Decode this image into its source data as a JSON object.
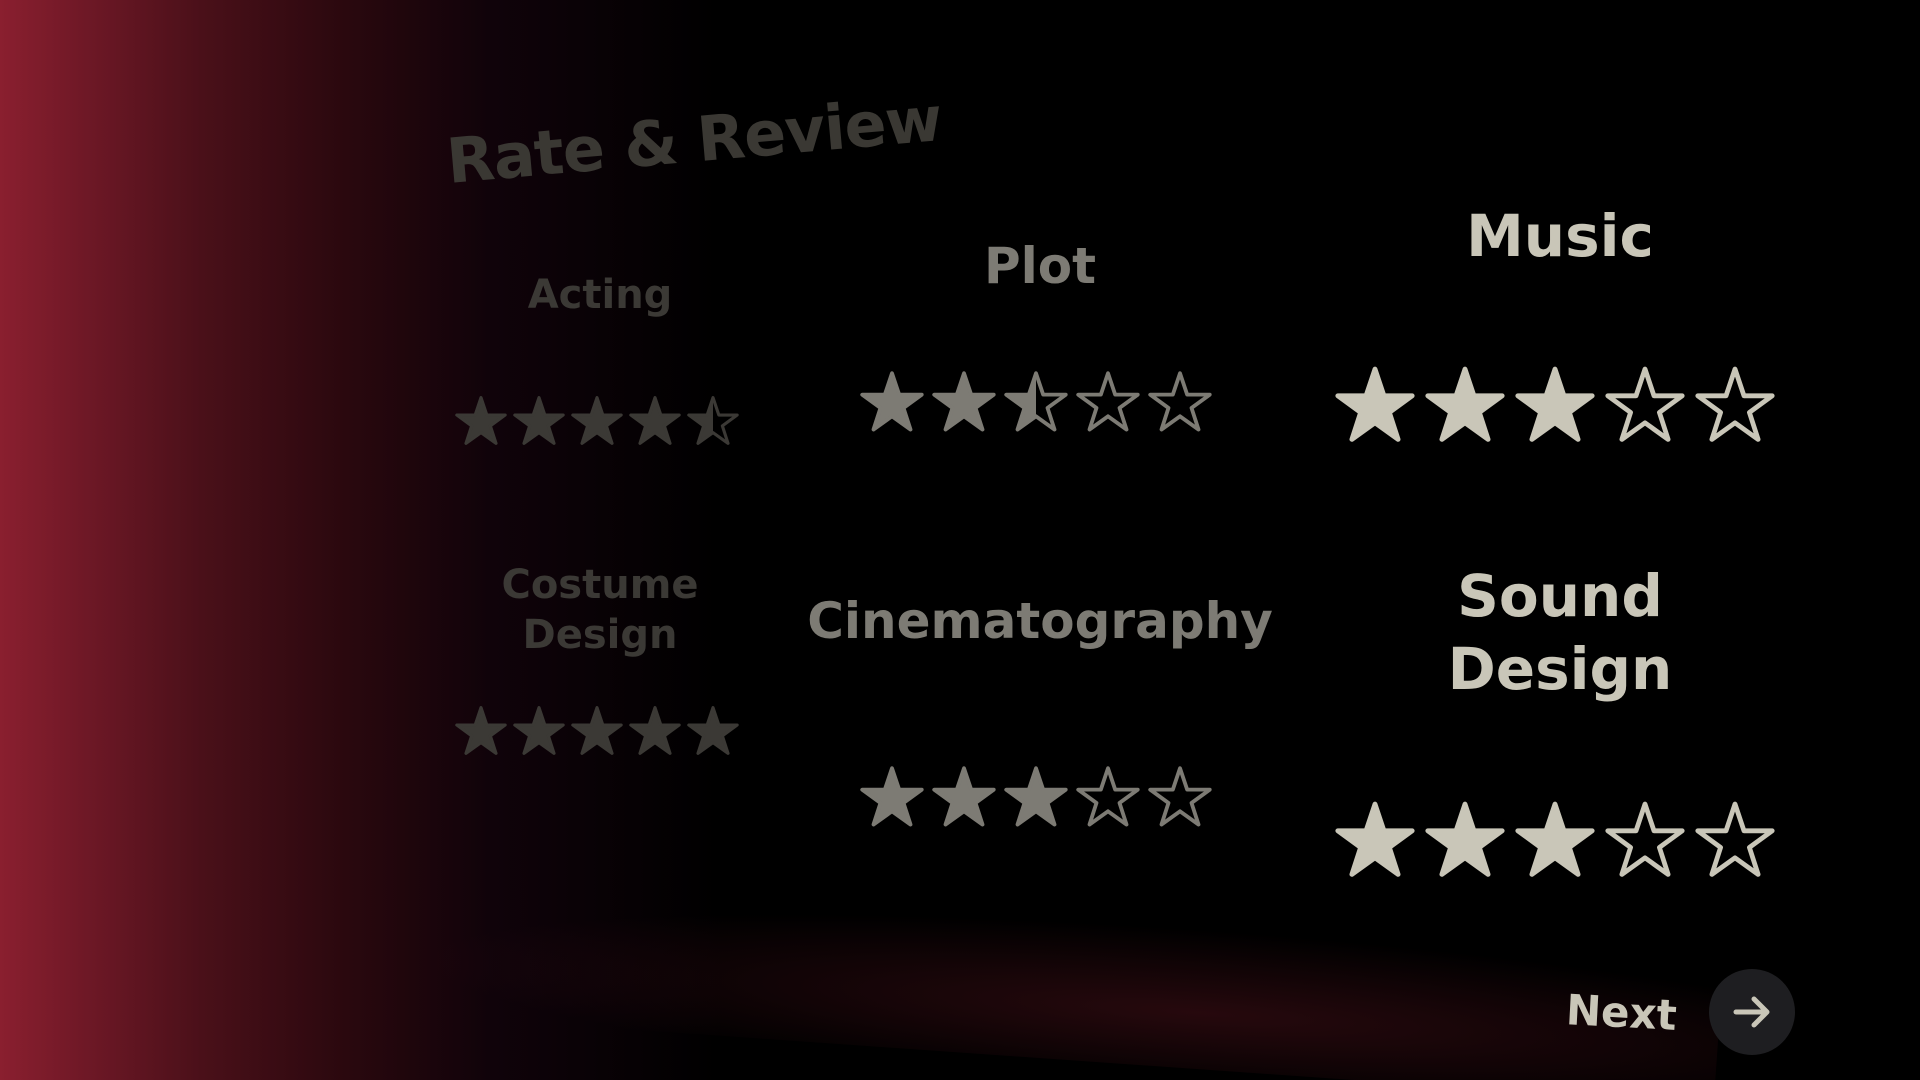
{
  "title": "Rate & Review",
  "categories": [
    {
      "label": "Acting",
      "rating": 4.5
    },
    {
      "label": "Plot",
      "rating": 2.5
    },
    {
      "label": "Music",
      "rating": 3
    },
    {
      "label": "Costume\nDesign",
      "rating": 5
    },
    {
      "label": "Cinematography",
      "rating": 3
    },
    {
      "label": "Sound\nDesign",
      "rating": 3
    }
  ],
  "max_stars": 5,
  "next": {
    "label": "Next"
  },
  "icons": {
    "star": "star-icon",
    "next": "arrow-right-icon"
  },
  "colors": {
    "accent_red": "#8a1f2f",
    "star_fill_near": "#c9c6b8",
    "star_fill_mid": "#7d7b74",
    "star_fill_far": "#3b3935",
    "button_bg": "#1e1e21"
  }
}
